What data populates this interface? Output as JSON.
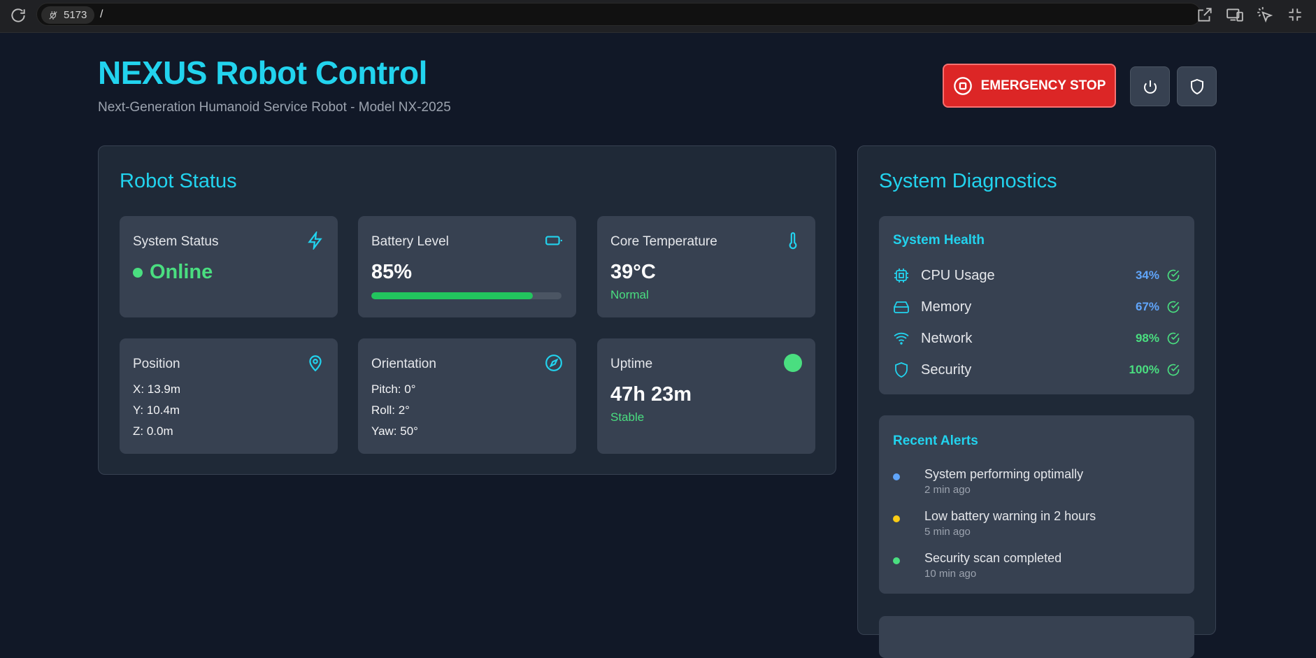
{
  "browser": {
    "port": "5173",
    "path": "/"
  },
  "header": {
    "title": "NEXUS Robot Control",
    "subtitle": "Next-Generation Humanoid Service Robot - Model NX-2025",
    "emergency_stop_label": "EMERGENCY STOP"
  },
  "robot_status": {
    "title": "Robot Status",
    "system_status": {
      "label": "System Status",
      "value": "Online"
    },
    "battery": {
      "label": "Battery Level",
      "value": "85%",
      "level_fraction": 0.85
    },
    "temperature": {
      "label": "Core Temperature",
      "value": "39°C",
      "state": "Normal"
    },
    "position": {
      "label": "Position",
      "x": "X: 13.9m",
      "y": "Y: 10.4m",
      "z": "Z: 0.0m"
    },
    "orientation": {
      "label": "Orientation",
      "pitch": "Pitch: 0°",
      "roll": "Roll: 2°",
      "yaw": "Yaw: 50°"
    },
    "uptime": {
      "label": "Uptime",
      "value": "47h 23m",
      "state": "Stable"
    }
  },
  "diagnostics": {
    "title": "System Diagnostics",
    "health": {
      "title": "System Health",
      "items": [
        {
          "label": "CPU Usage",
          "value": "34%",
          "icon": "cpu-icon",
          "color": "#60a5fa"
        },
        {
          "label": "Memory",
          "value": "67%",
          "icon": "hard-drive-icon",
          "color": "#60a5fa"
        },
        {
          "label": "Network",
          "value": "98%",
          "icon": "wifi-icon",
          "color": "#4ade80"
        },
        {
          "label": "Security",
          "value": "100%",
          "icon": "shield-icon",
          "color": "#4ade80"
        }
      ]
    },
    "alerts": {
      "title": "Recent Alerts",
      "items": [
        {
          "message": "System performing optimally",
          "time": "2 min ago",
          "color": "#60a5fa"
        },
        {
          "message": "Low battery warning in 2 hours",
          "time": "5 min ago",
          "color": "#facc15"
        },
        {
          "message": "Security scan completed",
          "time": "10 min ago",
          "color": "#4ade80"
        }
      ]
    }
  },
  "colors": {
    "accent": "#22d3ee",
    "background": "#111827",
    "panel": "#1f2937",
    "card": "#374151",
    "success": "#4ade80",
    "danger": "#dc2626"
  }
}
